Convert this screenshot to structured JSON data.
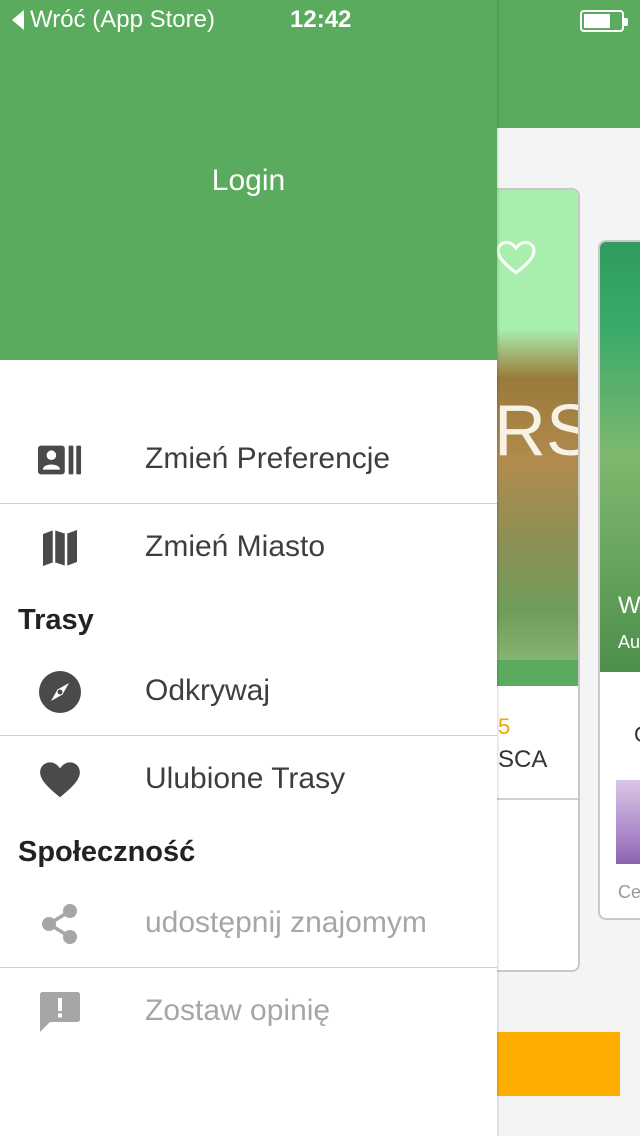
{
  "status_bar": {
    "back_label": "Wróć (App Store)",
    "time": "12:42"
  },
  "drawer": {
    "login_label": "Login",
    "items": [
      {
        "label": "Zmień Preferencje",
        "icon": "preferences-card-icon"
      },
      {
        "label": "Zmień Miasto",
        "icon": "map-icon"
      }
    ],
    "sections": [
      {
        "title": "Trasy",
        "items": [
          {
            "label": "Odkrywaj",
            "icon": "compass-icon"
          },
          {
            "label": "Ulubione Trasy",
            "icon": "heart-icon"
          }
        ]
      },
      {
        "title": "Społeczność",
        "items": [
          {
            "label": "udostępnij znajomym",
            "icon": "share-icon"
          },
          {
            "label": "Zostaw opinię",
            "icon": "feedback-icon"
          }
        ]
      }
    ]
  },
  "background": {
    "card1": {
      "rs_text": "RS",
      "number": "5",
      "name": "SCA"
    },
    "card2": {
      "title": "W",
      "subtitle": "Au",
      "meta": "C",
      "caption": "Ce"
    }
  },
  "colors": {
    "primary_green": "#5aab5d",
    "accent_orange": "#ffac00",
    "icon_dark": "#4a4a4a",
    "icon_disabled": "#a6a6a6"
  }
}
